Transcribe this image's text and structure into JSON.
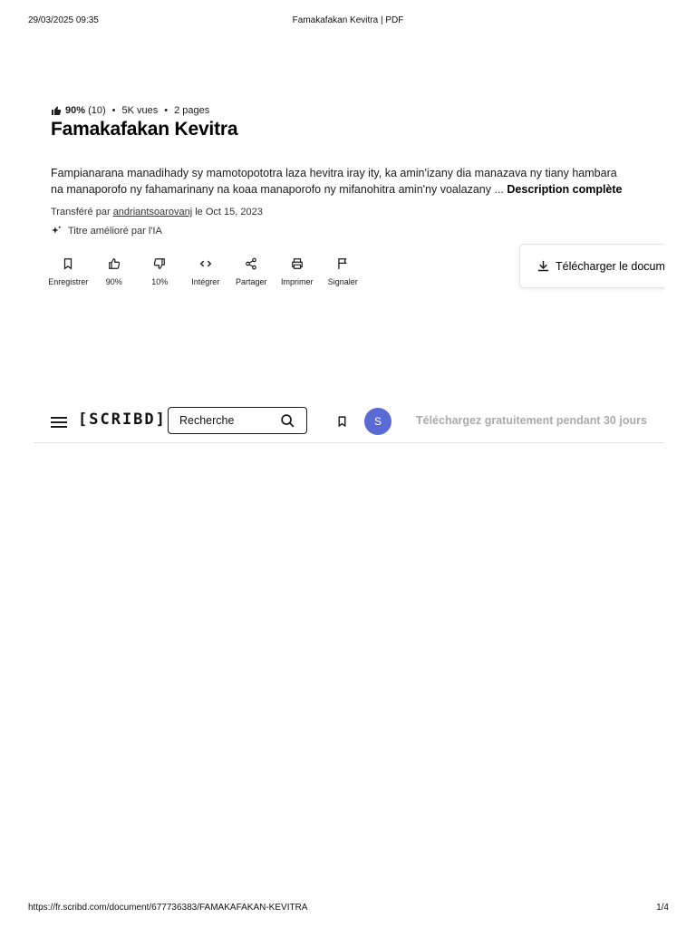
{
  "print_header": {
    "date": "29/03/2025 09:35",
    "title": "Famakafakan Kevitra | PDF"
  },
  "print_footer": {
    "url": "https://fr.scribd.com/document/677736383/FAMAKAFAKAN-KEVITRA",
    "page": "1/4"
  },
  "meta": {
    "rating": "90%",
    "rating_count": "(10)",
    "views": "5K vues",
    "pages": "2 pages"
  },
  "document": {
    "title": "Famakafakan Kevitra",
    "description": "Fampianarana manadihady sy mamotopototra laza hevitra iray ity, ka amin'izany dia manazava ny tiany hambara na manaporofo ny fahamarinany na koaa manaporofo ny mifanohitra amin'ny voalazany ...",
    "description_more": "Description complète",
    "uploaded_prefix": "Transféré par",
    "uploader": "andriantsoarovanj",
    "uploaded_suffix": "le Oct 15, 2023",
    "ai_note": "Titre amélioré par l'IA"
  },
  "actions": [
    {
      "label": "Enregistrer",
      "icon": "bookmark-icon"
    },
    {
      "label": "90%",
      "icon": "thumbs-up-icon"
    },
    {
      "label": "10%",
      "icon": "thumbs-down-icon"
    },
    {
      "label": "Intégrer",
      "icon": "code-icon"
    },
    {
      "label": "Partager",
      "icon": "share-icon"
    },
    {
      "label": "Imprimer",
      "icon": "printer-icon"
    },
    {
      "label": "Signaler",
      "icon": "flag-icon"
    }
  ],
  "download": {
    "label": "Télécharger le docume"
  },
  "navbar": {
    "logo": "[SCRIBD]",
    "search_placeholder": "Recherche",
    "avatar_initial": "S",
    "cta": "Téléchargez gratuitement pendant 30 jours"
  },
  "colors": {
    "avatar": "#5a6bd6",
    "cta_text": "#aaaaaa"
  }
}
